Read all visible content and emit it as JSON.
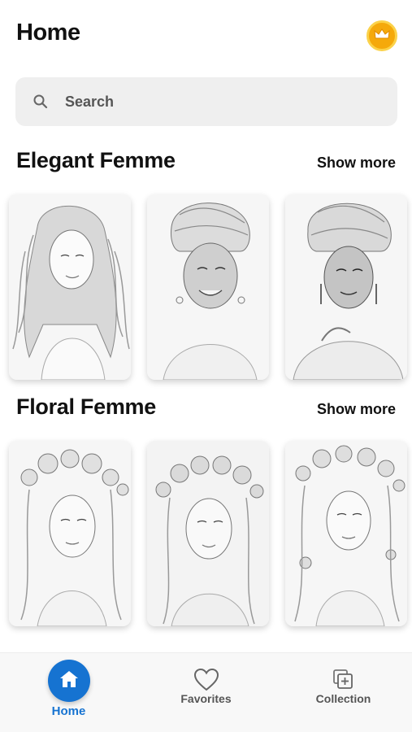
{
  "header": {
    "title": "Home",
    "premium_icon": "crown-icon"
  },
  "search": {
    "placeholder": "Search",
    "icon": "search-icon"
  },
  "sections": [
    {
      "title": "Elegant Femme",
      "show_more": "Show more",
      "cards": [
        "portrait-wavy-hair",
        "portrait-headwrap-smiling",
        "portrait-headwrap-earrings"
      ]
    },
    {
      "title": "Floral Femme",
      "show_more": "Show more",
      "cards": [
        "portrait-flower-crown-1",
        "portrait-flower-crown-2",
        "portrait-flower-crown-3"
      ]
    }
  ],
  "bottom_nav": {
    "items": [
      {
        "label": "Home",
        "icon": "home-icon",
        "active": true
      },
      {
        "label": "Favorites",
        "icon": "heart-icon",
        "active": false
      },
      {
        "label": "Collection",
        "icon": "collection-icon",
        "active": false
      }
    ]
  },
  "colors": {
    "accent": "#1673d1",
    "premium": "#f5a90b",
    "search_bg": "#efefef"
  }
}
